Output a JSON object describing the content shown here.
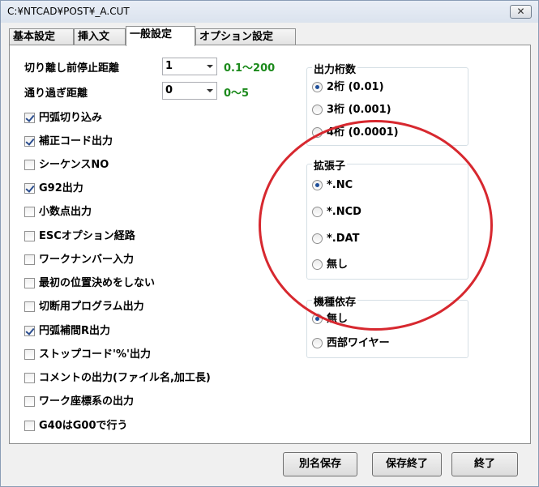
{
  "window": {
    "title": "C:¥NTCAD¥POST¥_A.CUT",
    "close_label": "✕"
  },
  "tabs": [
    {
      "label": "基本設定"
    },
    {
      "label": "挿入文"
    },
    {
      "label": "一般設定",
      "active": true
    },
    {
      "label": "オプション設定"
    }
  ],
  "fields": {
    "cut_stop": {
      "label": "切り離し前停止距離",
      "value": "1",
      "range": "0.1〜200"
    },
    "pass_over": {
      "label": "通り過ぎ距離",
      "value": "0",
      "range": "0〜5"
    }
  },
  "checkboxes": [
    {
      "label": "円弧切り込み",
      "checked": true
    },
    {
      "label": "補正コード出力",
      "checked": true
    },
    {
      "label": "シーケンスNO",
      "checked": false
    },
    {
      "label": "G92出力",
      "checked": true
    },
    {
      "label": "小数点出力",
      "checked": false
    },
    {
      "label": "ESCオプション経路",
      "checked": false
    },
    {
      "label": "ワークナンバー入力",
      "checked": false
    },
    {
      "label": "最初の位置決めをしない",
      "checked": false
    },
    {
      "label": "切断用プログラム出力",
      "checked": false
    },
    {
      "label": "円弧補間R出力",
      "checked": true
    },
    {
      "label": "ストップコード'%'出力",
      "checked": false
    },
    {
      "label": "コメントの出力(ファイル名,加工長)",
      "checked": false
    },
    {
      "label": "ワーク座標系の出力",
      "checked": false
    },
    {
      "label": "G40はG00で行う",
      "checked": false
    }
  ],
  "groups": {
    "digits": {
      "title": "出力桁数",
      "options": [
        {
          "label": "2桁 (0.01)",
          "checked": true
        },
        {
          "label": "3桁 (0.001)",
          "checked": false
        },
        {
          "label": "4桁 (0.0001)",
          "checked": false
        }
      ]
    },
    "extension": {
      "title": "拡張子",
      "options": [
        {
          "label": "*.NC",
          "checked": true
        },
        {
          "label": "*.NCD",
          "checked": false
        },
        {
          "label": "*.DAT",
          "checked": false
        },
        {
          "label": "無し",
          "checked": false
        }
      ]
    },
    "machine": {
      "title": "機種依存",
      "options": [
        {
          "label": "無し",
          "checked": true
        },
        {
          "label": "西部ワイヤー",
          "checked": false
        }
      ]
    }
  },
  "buttons": {
    "save_as": "別名保存",
    "save_exit": "保存終了",
    "exit": "終了"
  },
  "colors": {
    "hint": "#1c8a1c",
    "annotation": "#d7282f"
  }
}
